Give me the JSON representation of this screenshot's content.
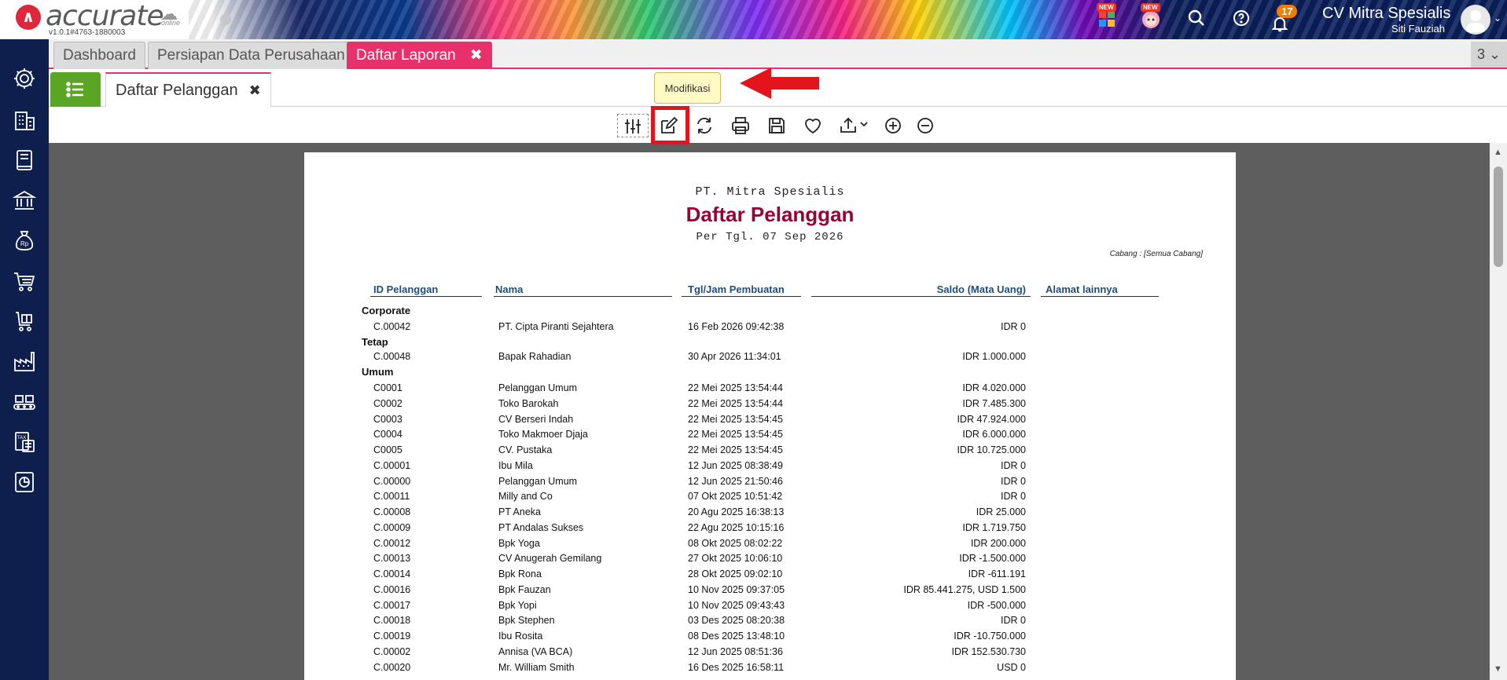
{
  "app": {
    "brand": "accurate",
    "brand_sub": "online",
    "version": "v1.0.1#4763-1880003",
    "new_badge_1": "NEW",
    "new_badge_2": "NEW",
    "notif_count": "17",
    "company": "CV Mitra Spesialis",
    "user": "Siti Fauziah"
  },
  "tabs_primary": [
    {
      "label": "Dashboard"
    },
    {
      "label": "Persiapan Data Perusahaan"
    },
    {
      "label": "Daftar Laporan"
    }
  ],
  "tabs_primary_close": "✖",
  "tab_count": "3",
  "tab_secondary": {
    "label": "Daftar Pelanggan",
    "close": "✖"
  },
  "tooltip": "Modifikasi",
  "report": {
    "company": "PT. Mitra Spesialis",
    "title": "Daftar Pelanggan",
    "date": "Per Tgl. 07 Sep 2026",
    "branch": "Cabang : [Semua Cabang]",
    "columns": [
      "ID Pelanggan",
      "Nama",
      "Tgl/Jam Pembuatan",
      "Saldo (Mata Uang)",
      "Alamat lainnya"
    ],
    "groups": [
      "Corporate",
      "Tetap",
      "Umum"
    ],
    "rows": [
      {
        "id": "C.00042",
        "name": "PT. Cipta Piranti Sejahtera",
        "created": "16 Feb 2026 09:42:38",
        "balance": "IDR 0"
      },
      {
        "id": "C.00048",
        "name": "Bapak Rahadian",
        "created": "30 Apr 2026 11:34:01",
        "balance": "IDR 1.000.000"
      },
      {
        "id": "C0001",
        "name": "Pelanggan Umum",
        "created": "22 Mei 2025 13:54:44",
        "balance": "IDR 4.020.000"
      },
      {
        "id": "C0002",
        "name": "Toko Barokah",
        "created": "22 Mei 2025 13:54:44",
        "balance": "IDR 7.485.300"
      },
      {
        "id": "C0003",
        "name": "CV Berseri Indah",
        "created": "22 Mei 2025 13:54:45",
        "balance": "IDR 47.924.000"
      },
      {
        "id": "C0004",
        "name": "Toko Makmoer Djaja",
        "created": "22 Mei 2025 13:54:45",
        "balance": "IDR 6.000.000"
      },
      {
        "id": "C0005",
        "name": "CV. Pustaka",
        "created": "22 Mei 2025 13:54:45",
        "balance": "IDR 10.725.000"
      },
      {
        "id": "C.00001",
        "name": "Ibu Mila",
        "created": "12 Jun 2025 08:38:49",
        "balance": "IDR 0"
      },
      {
        "id": "C.00000",
        "name": "Pelanggan Umum",
        "created": "12 Jun 2025 21:50:46",
        "balance": "IDR 0"
      },
      {
        "id": "C.00011",
        "name": "Milly and Co",
        "created": "07 Okt 2025 10:51:42",
        "balance": "IDR 0"
      },
      {
        "id": "C.00008",
        "name": "PT Aneka",
        "created": "20 Agu 2025 16:38:13",
        "balance": "IDR 25.000"
      },
      {
        "id": "C.00009",
        "name": "PT Andalas Sukses",
        "created": "22 Agu 2025 10:15:16",
        "balance": "IDR 1.719.750"
      },
      {
        "id": "C.00012",
        "name": "Bpk Yoga",
        "created": "08 Okt 2025 08:02:22",
        "balance": "IDR 200.000"
      },
      {
        "id": "C.00013",
        "name": "CV Anugerah Gemilang",
        "created": "27 Okt 2025 10:06:10",
        "balance": "IDR -1.500.000"
      },
      {
        "id": "C.00014",
        "name": "Bpk Rona",
        "created": "28 Okt 2025 09:02:10",
        "balance": "IDR -611.191"
      },
      {
        "id": "C.00016",
        "name": "Bpk Fauzan",
        "created": "10 Nov 2025 09:37:05",
        "balance": "IDR 85.441.275, USD 1.500"
      },
      {
        "id": "C.00017",
        "name": "Bpk Yopi",
        "created": "10 Nov 2025 09:43:43",
        "balance": "IDR -500.000"
      },
      {
        "id": "C.00018",
        "name": "Bpk Stephen",
        "created": "03 Des 2025 08:20:38",
        "balance": "IDR 0"
      },
      {
        "id": "C.00019",
        "name": "Ibu Rosita",
        "created": "08 Des 2025 13:48:10",
        "balance": "IDR -10.750.000"
      },
      {
        "id": "C.00002",
        "name": "Annisa (VA BCA)",
        "created": "12 Jun 2025 08:51:36",
        "balance": "IDR 152.530.730"
      },
      {
        "id": "C.00020",
        "name": "Mr. William Smith",
        "created": "16 Des 2025 16:58:11",
        "balance": "USD 0"
      }
    ]
  }
}
